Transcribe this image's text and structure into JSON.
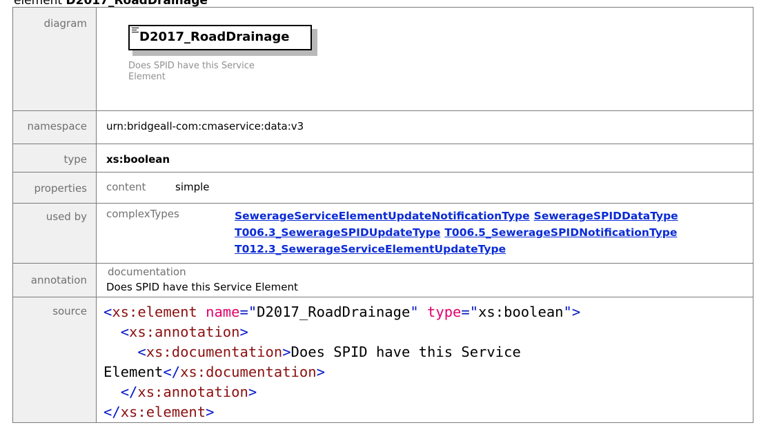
{
  "heading": {
    "prefix": "element",
    "name": "D2017_RoadDrainage"
  },
  "rows": {
    "diagram": {
      "label": "diagram",
      "element_name": "D2017_RoadDrainage",
      "note": "Does SPID have this Service Element"
    },
    "namespace": {
      "label": "namespace",
      "value": "urn:bridgeall-com:cmaservice:data:v3"
    },
    "type": {
      "label": "type",
      "value": "xs:boolean"
    },
    "properties": {
      "label": "properties",
      "key": "content",
      "value": "simple"
    },
    "used_by": {
      "label": "used by",
      "key": "complexTypes",
      "links": [
        "SewerageServiceElementUpdateNotificationType",
        "SewerageSPIDDataType",
        "T006.3_SewerageSPIDUpdateType",
        "T006.5_SewerageSPIDNotificationType",
        "T012.3_SewerageServiceElementUpdateType"
      ]
    },
    "annotation": {
      "label": "annotation",
      "key": "documentation",
      "value": "Does SPID have this Service Element"
    },
    "source": {
      "label": "source",
      "code": {
        "l1_open": "<",
        "l1_tag": "xs:element",
        "l1_attr1": " name",
        "l1_eq1": "=\"",
        "l1_val1": "D2017_RoadDrainage",
        "l1_q1": "\"",
        "l1_attr2": " type",
        "l1_eq2": "=\"",
        "l1_val2": "xs:boolean",
        "l1_close": "\">",
        "l2_indent": "  ",
        "l2_open": "<",
        "l2_tag": "xs:annotation",
        "l2_close": ">",
        "l3_indent": "    ",
        "l3_open": "<",
        "l3_tag": "xs:documentation",
        "l3_close": ">",
        "l3_text": "Does SPID have this Service",
        "l4_text": "Element",
        "l4_open": "</",
        "l4_tag": "xs:documentation",
        "l4_close": ">",
        "l5_indent": "  ",
        "l5_open": "</",
        "l5_tag": "xs:annotation",
        "l5_close": ">",
        "l6_open": "</",
        "l6_tag": "xs:element",
        "l6_close": ">"
      }
    }
  }
}
